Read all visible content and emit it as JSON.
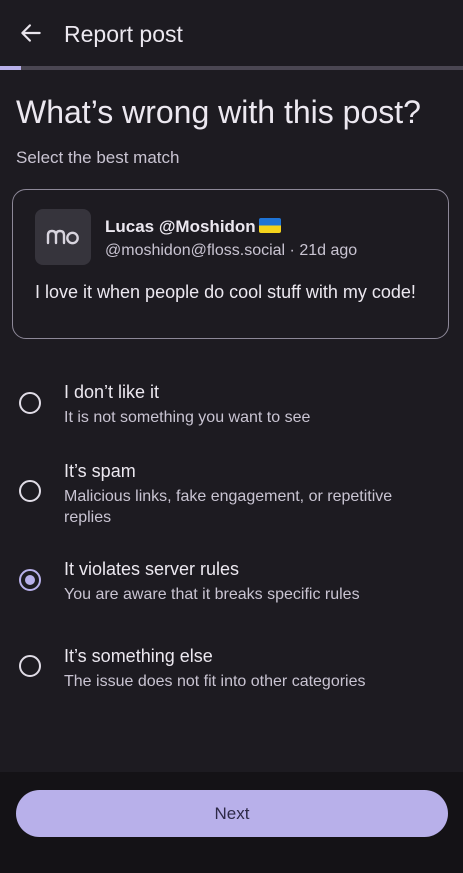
{
  "header": {
    "title": "Report post",
    "back_icon": "arrow-back-icon"
  },
  "progress": {
    "fraction": 0.045,
    "color": "#b8b0ea"
  },
  "main": {
    "heading": "What’s wrong with this post?",
    "subheading": "Select the best match"
  },
  "post": {
    "avatar_text": "mo",
    "author": "Lucas @Moshidon",
    "author_flag_icon": "ukraine-flag-icon",
    "handle_meta": "@moshidon@floss.social · 21d ago",
    "content": "I love it when people do cool stuff with my code!"
  },
  "options": [
    {
      "title": "I don’t like it",
      "description": "It is not something you want to see",
      "selected": false
    },
    {
      "title": "It’s spam",
      "description": "Malicious links, fake engagement, or repetitive replies",
      "selected": false
    },
    {
      "title": "It violates server rules",
      "description": "You are aware that it breaks specific rules",
      "selected": true
    },
    {
      "title": "It’s something else",
      "description": "The issue does not fit into other categories",
      "selected": false
    }
  ],
  "footer": {
    "next_label": "Next"
  },
  "colors": {
    "accent": "#b8b0ea",
    "background": "#1d1b21",
    "bottom_bar": "#141216"
  }
}
